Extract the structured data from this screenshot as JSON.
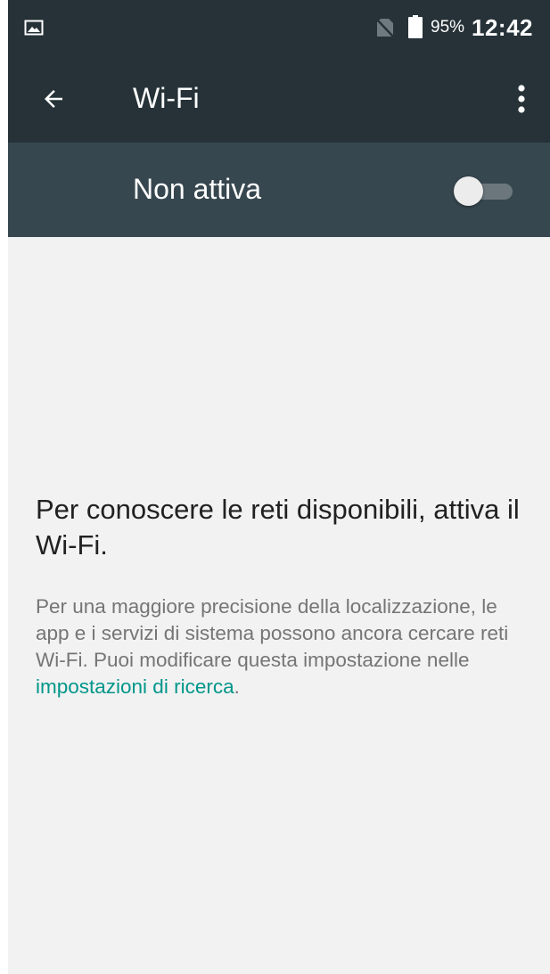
{
  "status_bar": {
    "gallery_icon": "image-notification-icon",
    "sim_icon": "no-sim-icon",
    "battery_icon": "battery-icon",
    "battery_percent": "95%",
    "time": "12:42"
  },
  "toolbar": {
    "back_icon": "arrow-back-icon",
    "title": "Wi-Fi",
    "overflow_icon": "more-vert-icon"
  },
  "wifi_switch": {
    "label": "Non attiva",
    "enabled": false
  },
  "empty_state": {
    "title": "Per conoscere le reti disponibili, attiva il Wi-Fi.",
    "description_before_link": "Per una maggiore precisione della localizzazione, le app e i servizi di sistema possono ancora cercare reti Wi-Fi. Puoi modificare questa impostazione nelle ",
    "link_text": "impostazioni di ricerca",
    "description_after_link": "."
  },
  "colors": {
    "toolbar_bg": "#263238",
    "switch_bar_bg": "#37474f",
    "page_bg": "#f2f2f2",
    "link": "#00968a"
  }
}
